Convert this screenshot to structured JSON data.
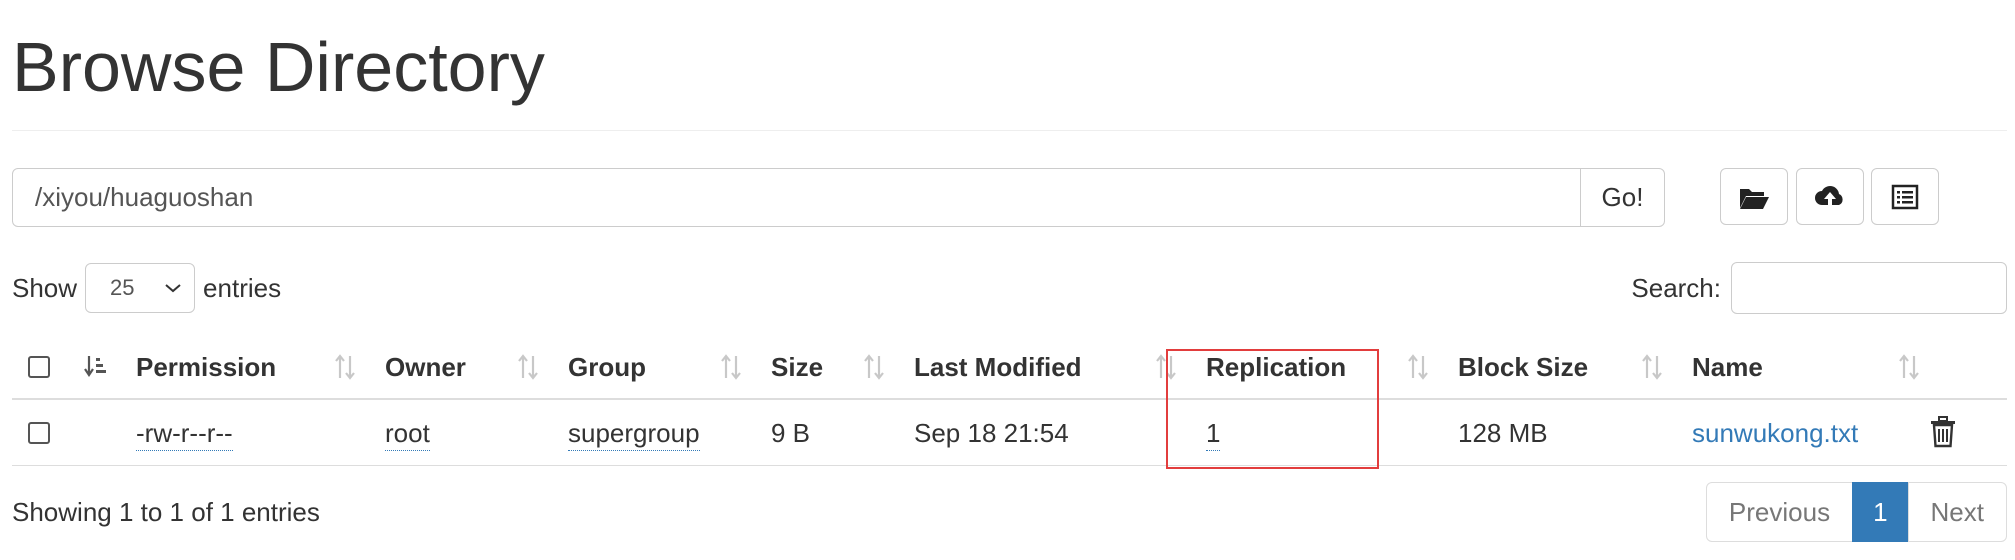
{
  "page_title": "Browse Directory",
  "path_bar": {
    "value": "/xiyou/huaguoshan",
    "go_label": "Go!"
  },
  "toolbar": {
    "buttons": [
      {
        "icon": "folder-open-icon"
      },
      {
        "icon": "cloud-upload-icon"
      },
      {
        "icon": "list-alt-icon"
      }
    ]
  },
  "length_menu": {
    "show_label": "Show",
    "selected": "25",
    "entries_label": "entries"
  },
  "search": {
    "label": "Search:",
    "value": ""
  },
  "table": {
    "columns": [
      "Permission",
      "Owner",
      "Group",
      "Size",
      "Last Modified",
      "Replication",
      "Block Size",
      "Name"
    ],
    "rows": [
      {
        "permission": "-rw-r--r--",
        "owner": "root",
        "group": "supergroup",
        "size": "9 B",
        "last_modified": "Sep 18 21:54",
        "replication": "1",
        "block_size": "128 MB",
        "name": "sunwukong.txt"
      }
    ]
  },
  "info_text": "Showing 1 to 1 of 1 entries",
  "pagination": {
    "previous": "Previous",
    "current": "1",
    "next": "Next"
  },
  "colors": {
    "link": "#337ab7",
    "active_page": "#337ab7",
    "highlight": "#e23d3d"
  }
}
